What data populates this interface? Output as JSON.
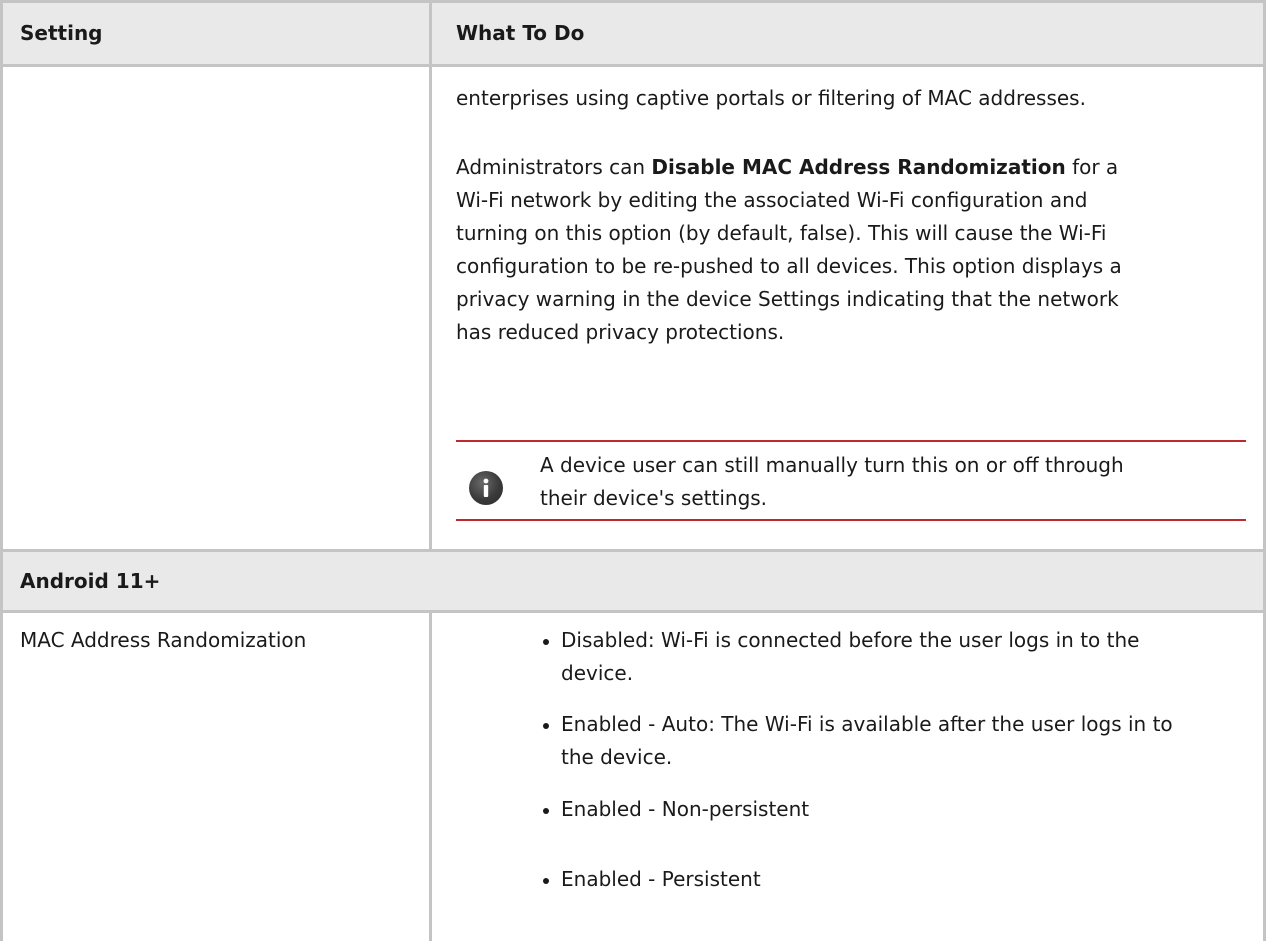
{
  "table": {
    "headers": {
      "setting": "Setting",
      "what_to_do": "What To Do"
    },
    "continued_row": {
      "line1": "enterprises using captive portals or filtering of MAC addresses.",
      "para_prefix": "Administrators can ",
      "para_bold": "Disable MAC Address Randomization",
      "para_rest_line1": " for a",
      "para_lines": [
        "Wi-Fi network by editing the associated Wi-Fi configuration and",
        "turning on this option (by default, false). This will cause the Wi-Fi",
        "configuration to be re-pushed to all devices. This option displays a",
        "privacy warning in the device Settings indicating that the network",
        "has reduced privacy protections."
      ],
      "note": {
        "icon": "info-icon",
        "line1": "A device user can still manually turn this on or off through",
        "line2": "their device's settings.",
        "rule_color": "#c0282d"
      }
    },
    "section": {
      "label": "Android 11+"
    },
    "mac_row": {
      "setting": "MAC Address Randomization",
      "options": [
        {
          "line1": "Disabled: Wi-Fi is connected before the user logs in to the",
          "line2": "device."
        },
        {
          "line1": "Enabled - Auto: The Wi-Fi is available after the user logs in to",
          "line2": "the device."
        },
        {
          "line1": "Enabled - Non-persistent",
          "line2": ""
        },
        {
          "line1": "Enabled - Persistent",
          "line2": ""
        }
      ]
    }
  }
}
